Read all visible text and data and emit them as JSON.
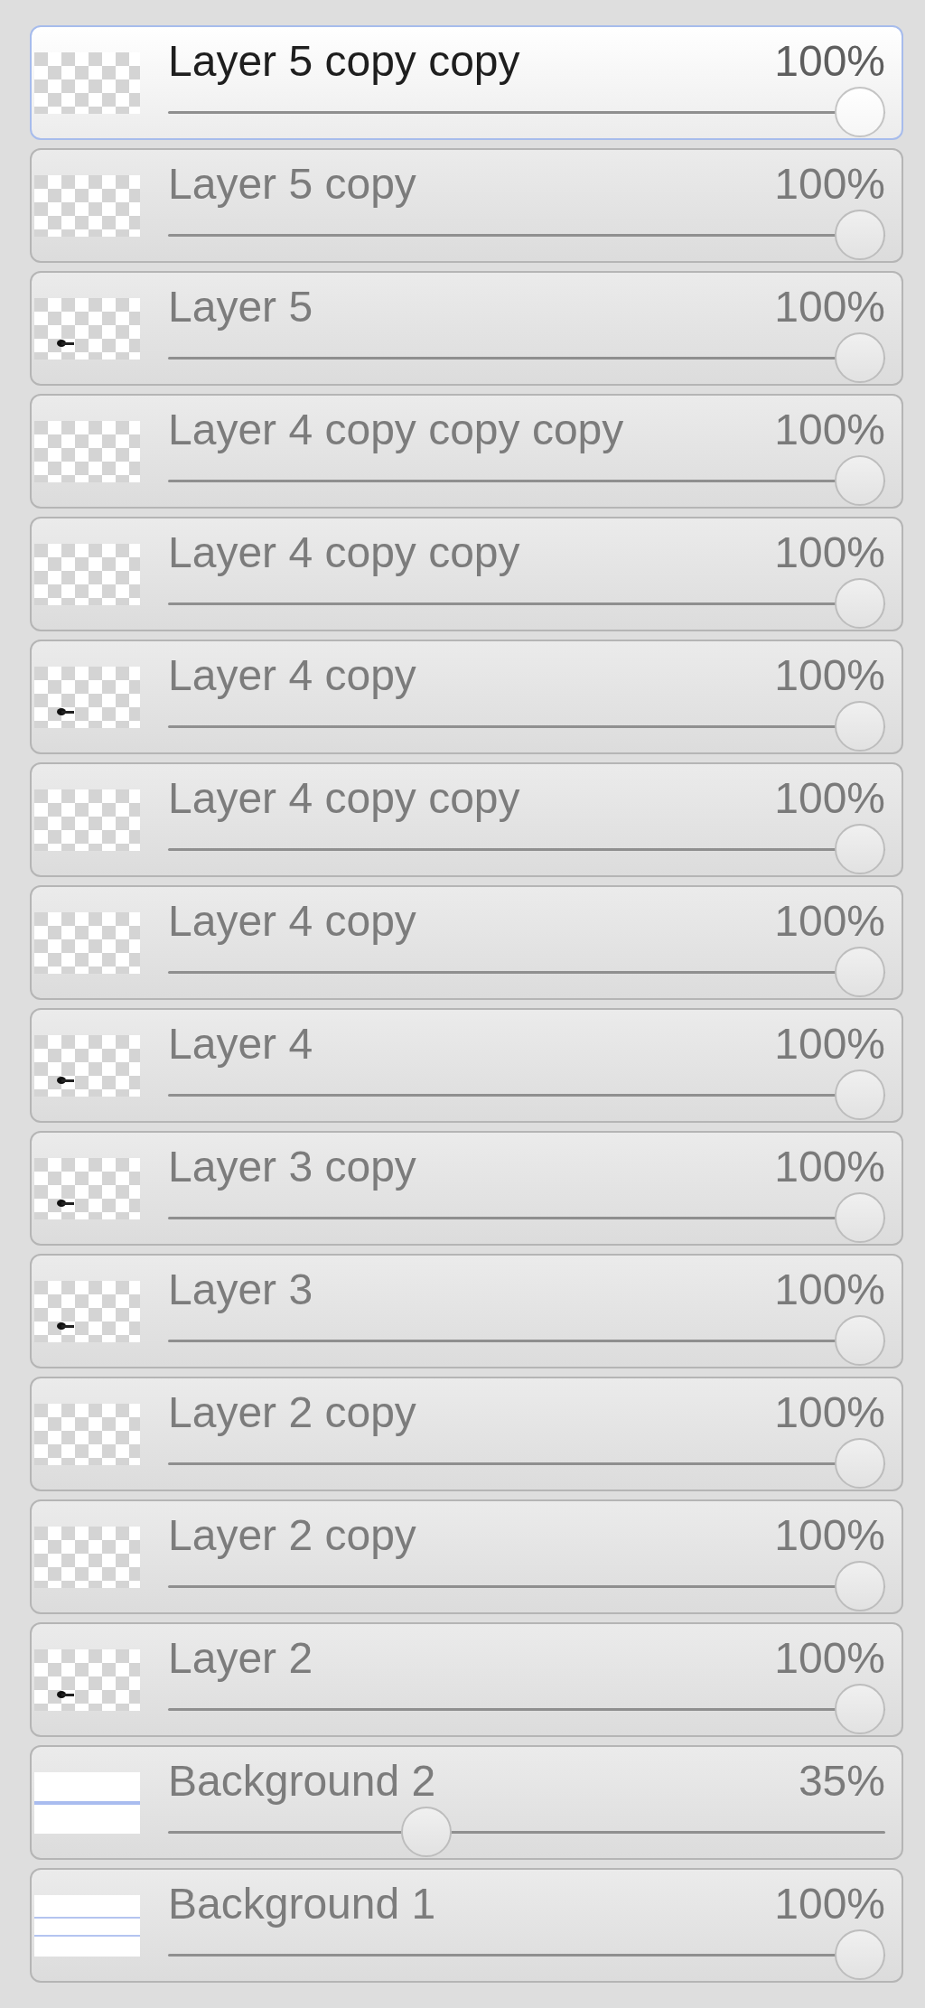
{
  "layers": [
    {
      "name": "Layer 5 copy copy",
      "opacity": "100%",
      "level": 1,
      "selected": true,
      "kind": "transparent"
    },
    {
      "name": "Layer 5 copy",
      "opacity": "100%",
      "level": 1,
      "selected": false,
      "kind": "transparent"
    },
    {
      "name": "Layer 5",
      "opacity": "100%",
      "level": 1,
      "selected": false,
      "kind": "marked"
    },
    {
      "name": "Layer 4 copy copy copy",
      "opacity": "100%",
      "level": 1,
      "selected": false,
      "kind": "transparent"
    },
    {
      "name": "Layer 4 copy copy",
      "opacity": "100%",
      "level": 1,
      "selected": false,
      "kind": "transparent"
    },
    {
      "name": "Layer 4 copy",
      "opacity": "100%",
      "level": 1,
      "selected": false,
      "kind": "marked"
    },
    {
      "name": "Layer 4 copy copy",
      "opacity": "100%",
      "level": 1,
      "selected": false,
      "kind": "transparent"
    },
    {
      "name": "Layer 4 copy",
      "opacity": "100%",
      "level": 1,
      "selected": false,
      "kind": "transparent"
    },
    {
      "name": "Layer 4",
      "opacity": "100%",
      "level": 1,
      "selected": false,
      "kind": "marked"
    },
    {
      "name": "Layer 3 copy",
      "opacity": "100%",
      "level": 1,
      "selected": false,
      "kind": "marked"
    },
    {
      "name": "Layer 3",
      "opacity": "100%",
      "level": 1,
      "selected": false,
      "kind": "marked"
    },
    {
      "name": "Layer 2 copy",
      "opacity": "100%",
      "level": 1,
      "selected": false,
      "kind": "transparent"
    },
    {
      "name": "Layer 2 copy",
      "opacity": "100%",
      "level": 1,
      "selected": false,
      "kind": "transparent"
    },
    {
      "name": "Layer 2",
      "opacity": "100%",
      "level": 1,
      "selected": false,
      "kind": "marked"
    },
    {
      "name": "Background 2",
      "opacity": "35%",
      "level": 0.35,
      "selected": false,
      "kind": "lined"
    },
    {
      "name": "Background 1",
      "opacity": "100%",
      "level": 1,
      "selected": false,
      "kind": "striped"
    }
  ]
}
